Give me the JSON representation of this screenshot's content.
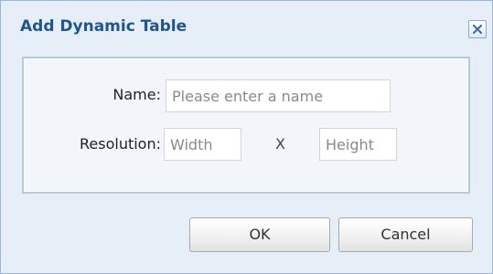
{
  "dialog": {
    "title": "Add Dynamic Table",
    "close_icon": "close-icon"
  },
  "form": {
    "name_label": "Name:",
    "name_placeholder": "Please enter a name",
    "name_value": "",
    "resolution_label": "Resolution:",
    "width_placeholder": "Width",
    "width_value": "",
    "separator": "X",
    "height_placeholder": "Height",
    "height_value": ""
  },
  "buttons": {
    "ok_label": "OK",
    "cancel_label": "Cancel"
  },
  "colors": {
    "title": "#20558f",
    "dialog_background": "#e6eef8",
    "panel_border": "#b5c9e2"
  }
}
